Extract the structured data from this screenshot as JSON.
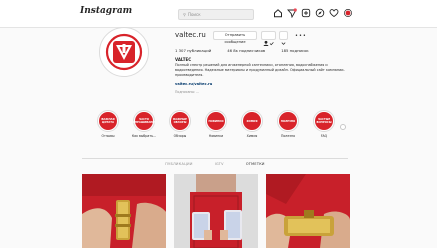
{
  "topbar": {
    "logo": "Instagram",
    "search_placeholder": "Поиск"
  },
  "profile": {
    "username": "valtec.ru",
    "message_button": "Отправить сообщение",
    "stats": [
      "1 307 публикаций",
      "46 8к подписчиков",
      "185 подписок"
    ],
    "name": "VALTEC",
    "bio": "Полный спектр решений для инженерной сантехники, отопления, водоснабжения и водоотведения. Надежные материалы и продуманный дизайн. Официальный сайт компании-производителя.",
    "link": "valtec.ru/valtec.ru",
    "followed_by": "Подписаны: ...",
    "brand_color": "#d8232a"
  },
  "highlights": [
    {
      "inner": "ВАЖНАЯ ЦИТАТА",
      "label": "Отзывы"
    },
    {
      "inner": "ЧАСТО СПРАШИВАЮТ",
      "label": "Как выбрать..."
    },
    {
      "inner": "ВАЖНЫЕ ОБЗОРЫ",
      "label": "Обзоры"
    },
    {
      "inner": "НОВИНКИ",
      "label": "Новинки"
    },
    {
      "inner": "ХИМИЯ",
      "label": "Химия"
    },
    {
      "inner": "ПОЛЕЗНО",
      "label": "Полезно"
    },
    {
      "inner": "ЧАСТЫЕ ВОПРОСЫ",
      "label": "FAQ"
    }
  ],
  "tabs": [
    {
      "label": "ПУБЛИКАЦИИ",
      "active": false
    },
    {
      "label": "IGTV",
      "active": false
    },
    {
      "label": "ОТМЕТКИ",
      "active": true
    }
  ]
}
